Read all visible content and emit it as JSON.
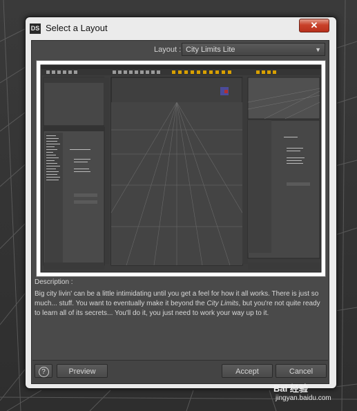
{
  "dialog": {
    "title": "Select a Layout",
    "app_icon_text": "DS",
    "close_symbol": "✕"
  },
  "layout_selector": {
    "label": "Layout :",
    "selected": "City Limits Lite"
  },
  "description": {
    "label": "Description :",
    "text_part1": "Big city livin' can be a little intimidating until you get a feel for how it all works. There is just so much... stuff. You want to eventually make it beyond the ",
    "text_emph": "City Limits",
    "text_part2": ", but you're not quite ready to learn all of its secrets... You'll do it, you just need to work your way up to it."
  },
  "buttons": {
    "help_symbol": "?",
    "preview": "Preview",
    "accept": "Accept",
    "cancel": "Cancel"
  },
  "watermark": {
    "brand": "Bai 经验",
    "url": "jingyan.baidu.com"
  },
  "icons": [
    "app-icon",
    "close-icon",
    "chevron-down-icon",
    "help-icon"
  ]
}
